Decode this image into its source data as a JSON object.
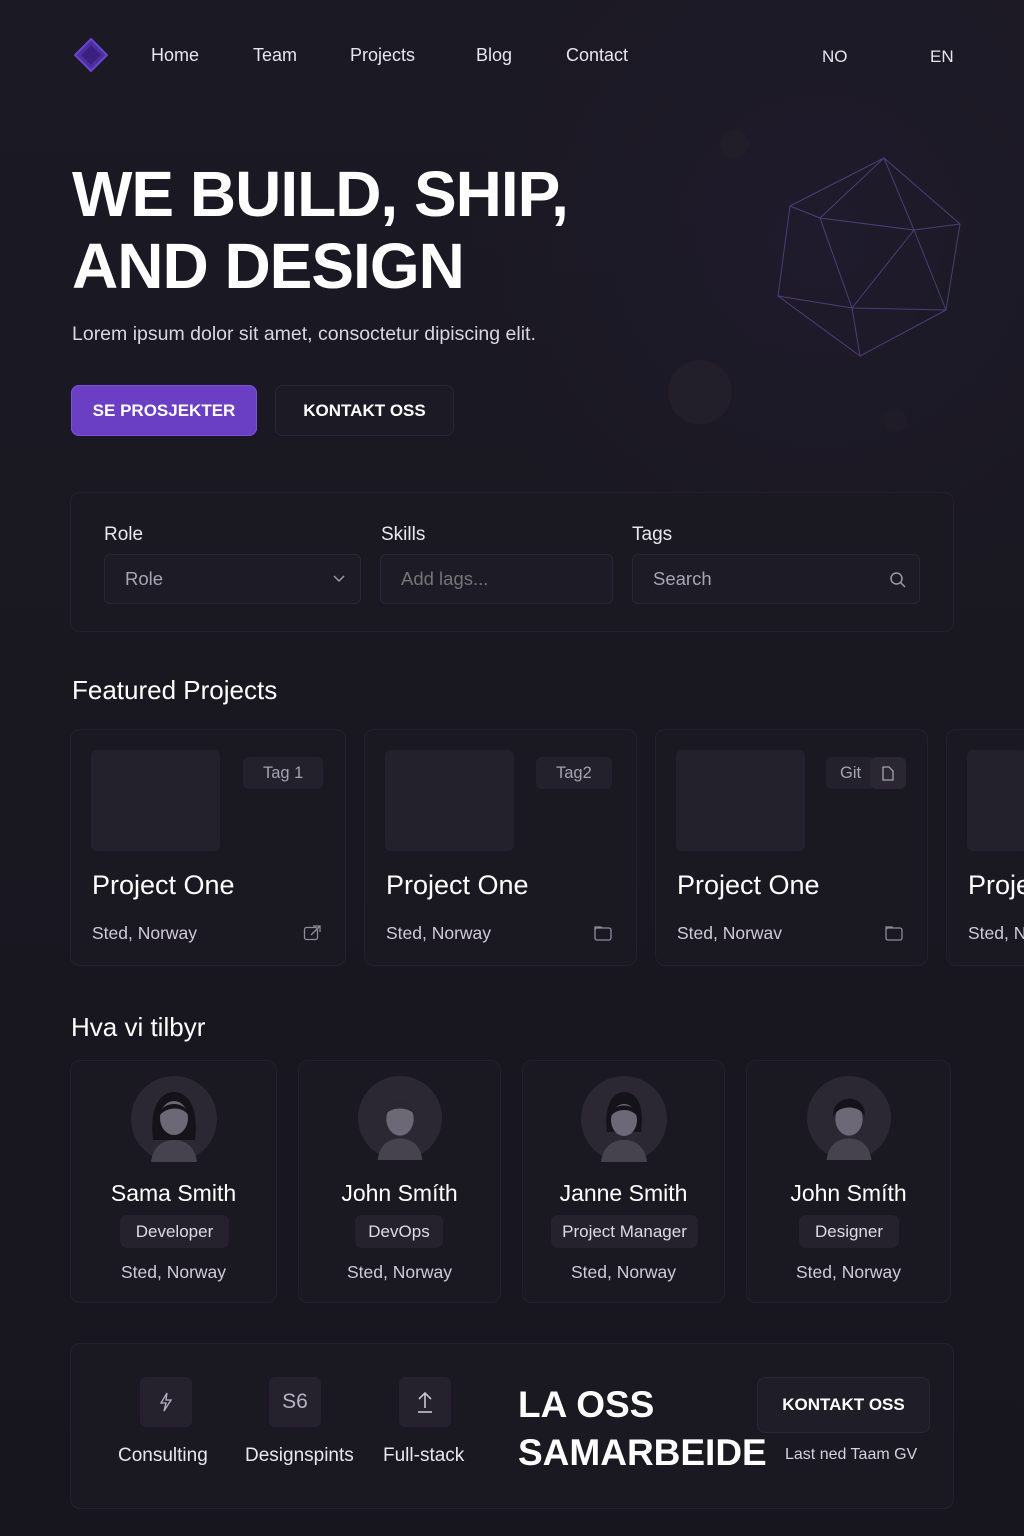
{
  "nav": {
    "logo_icon": "purple-diamond-logo",
    "links": [
      {
        "label": "Home"
      },
      {
        "label": "Team"
      },
      {
        "label": "Projects"
      },
      {
        "label": "Blog"
      },
      {
        "label": "Contact"
      }
    ],
    "languages": [
      "NO",
      "EN"
    ]
  },
  "hero": {
    "title_line1": "WE BUILD, SHIP,",
    "title_line2": "AND DESIGN",
    "subtitle": "Lorem ipsum dolor sit amet, consoctetur dipiscing elit.",
    "primary_button": "SE PROSJEKTER",
    "secondary_button": "KONTAKT OSS",
    "accent_color": "#6a3fc4"
  },
  "filters": {
    "role": {
      "label": "Role",
      "value": "Role"
    },
    "skills": {
      "label": "Skills",
      "placeholder": "Add lags..."
    },
    "tags": {
      "label": "Tags",
      "placeholder": "Search"
    }
  },
  "featured": {
    "title": "Featured Projects",
    "projects": [
      {
        "tag": "Tag 1",
        "title": "Project One",
        "location": "Sted, Norway",
        "icon": "external-link-icon"
      },
      {
        "tag": "Tag2",
        "title": "Project One",
        "location": "Sted, Norway",
        "icon": "folder-icon"
      },
      {
        "tag": "Git",
        "title": "Project One",
        "location": "Sted, Norwav",
        "icon": "folder-icon"
      },
      {
        "tag": "",
        "title": "Proje",
        "location": "Sted, N",
        "icon": ""
      }
    ]
  },
  "team": {
    "title": "Hva vi tilbyr",
    "members": [
      {
        "name": "Sama Smith",
        "role": "Developer",
        "location": "Sted, Norway"
      },
      {
        "name": "John Smíth",
        "role": "DevOps",
        "location": "Sted, Norway"
      },
      {
        "name": "Janne Smith",
        "role": "Project Manager",
        "location": "Sted, Norway"
      },
      {
        "name": "John Smíth",
        "role": "Designer",
        "location": "Sted, Norway"
      }
    ]
  },
  "cta": {
    "services": [
      {
        "icon": "lightning-icon",
        "label": "Consulting"
      },
      {
        "icon": "s6-icon",
        "icon_text": "S6",
        "label": "Designspints"
      },
      {
        "icon": "upload-arrow-icon",
        "label": "Full-stack"
      }
    ],
    "title_line1": "LA OSS",
    "title_line2": "SAMARBEIDE",
    "button": "KONTAKT OSS",
    "note": "Last ned Taam GV"
  }
}
